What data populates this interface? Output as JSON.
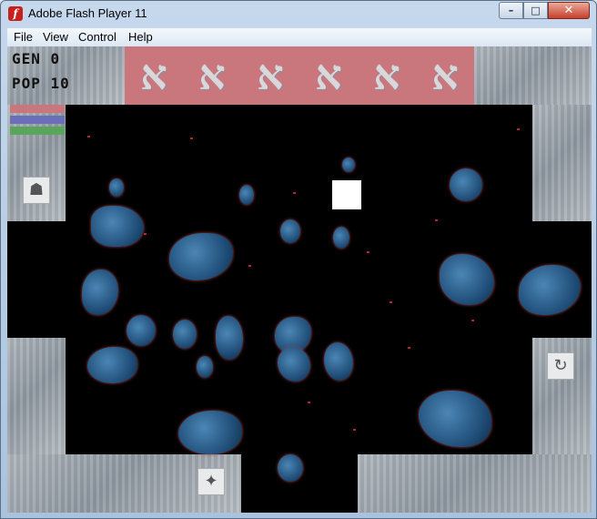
{
  "window": {
    "title": "Adobe Flash Player 11",
    "controls": {
      "minimize": "–",
      "maximize": "□",
      "close": "✕"
    }
  },
  "menu": {
    "items": [
      {
        "label": "File"
      },
      {
        "label": "View"
      },
      {
        "label": "Control"
      },
      {
        "label": "Help"
      }
    ]
  },
  "game": {
    "gen_label": "GEN 0",
    "pop_label": "POP 10",
    "banner_glyphs": [
      "א",
      "א",
      "א",
      "א",
      "א",
      "א"
    ],
    "color_bars": [
      "#c9777c",
      "#6b6fb8",
      "#5aa45c"
    ],
    "tools": {
      "rock": "rock-icon",
      "shuriken": "shuriken-icon",
      "rotate": "rotate-icon"
    }
  }
}
